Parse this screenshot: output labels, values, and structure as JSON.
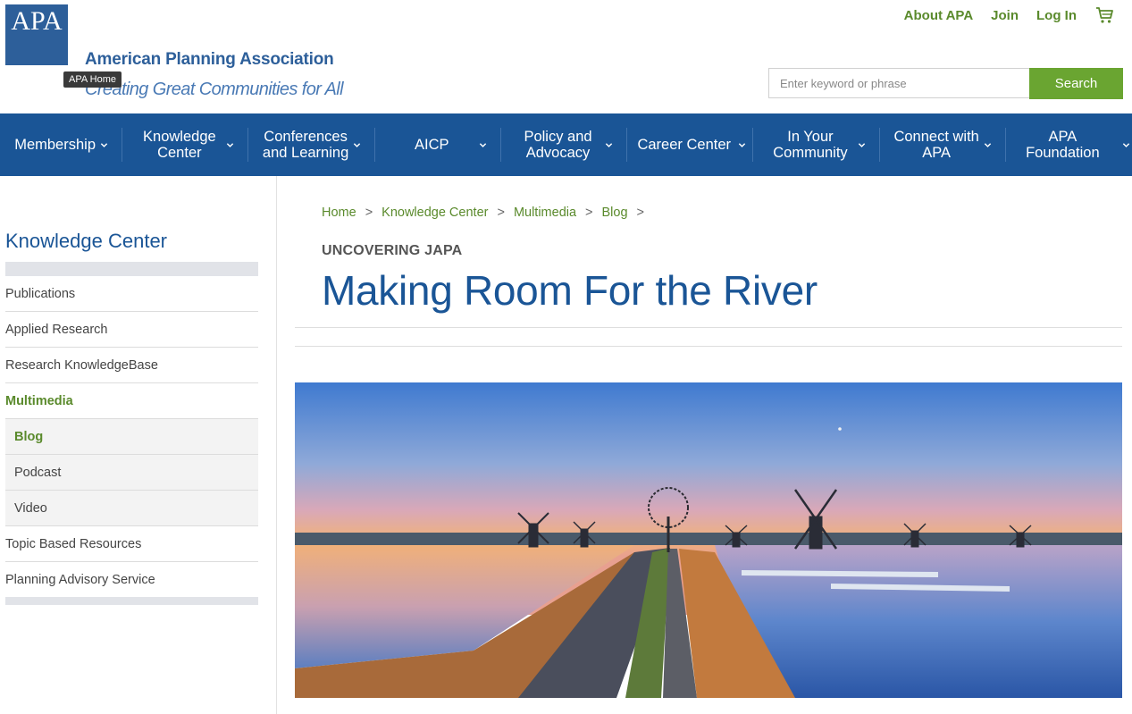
{
  "header": {
    "logo_text": "APA",
    "org_name": "American Planning Association",
    "tagline": "Creating Great Communities for All",
    "tooltip": "APA Home",
    "top_links": [
      "About APA",
      "Join",
      "Log In"
    ],
    "cart_icon": "cart-icon"
  },
  "search": {
    "placeholder": "Enter keyword or phrase",
    "button_label": "Search"
  },
  "nav": {
    "items": [
      "Membership",
      "Knowledge Center",
      "Conferences and Learning",
      "AICP",
      "Policy and Advocacy",
      "Career Center",
      "In Your Community",
      "Connect with APA",
      "APA Foundation"
    ],
    "chevron_icon": "chevron-down-icon"
  },
  "sidebar": {
    "title": "Knowledge Center",
    "items": [
      {
        "label": "Publications"
      },
      {
        "label": "Applied Research"
      },
      {
        "label": "Research KnowledgeBase"
      },
      {
        "label": "Multimedia"
      },
      {
        "label": "Blog"
      },
      {
        "label": "Podcast"
      },
      {
        "label": "Video"
      },
      {
        "label": "Topic Based Resources"
      },
      {
        "label": "Planning Advisory Service"
      }
    ]
  },
  "breadcrumb": [
    "Home",
    "Knowledge Center",
    "Multimedia",
    "Blog"
  ],
  "breadcrumb_sep": ">",
  "article": {
    "kicker": "UNCOVERING JAPA",
    "title": "Making Room For the River"
  },
  "colors": {
    "brand_blue": "#1a5596",
    "accent_green": "#6aa531",
    "link_green": "#5a8a2c"
  }
}
